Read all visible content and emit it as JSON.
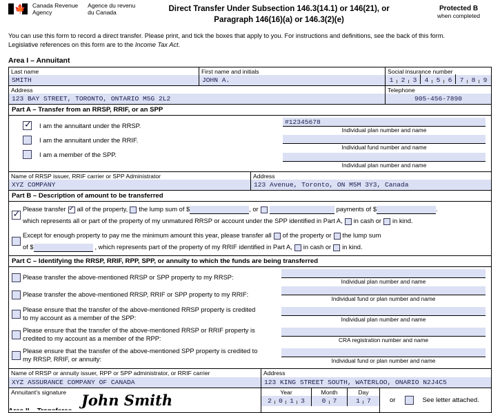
{
  "header": {
    "agency_en": "Canada Revenue\nAgency",
    "agency_en_l1": "Canada Revenue",
    "agency_en_l2": "Agency",
    "agency_fr_l1": "Agence du revenu",
    "agency_fr_l2": "du Canada",
    "title_line1": "Direct Transfer Under Subsection 146.3(14.1) or 146(21), or",
    "title_line2": "Paragraph 146(16)(a) or 146.3(2)(e)",
    "protected_label": "Protected B",
    "protected_sub": "when completed"
  },
  "intro": {
    "line1": "You can use this form to record a direct transfer. Please print, and tick the boxes that apply to you. For instructions and definitions, see the back of this form.",
    "line2_pre": "Legislative references on this form are to the ",
    "line2_italic": "Income Tax Act",
    "line2_post": "."
  },
  "area1": {
    "title": "Area I – Annuitant",
    "last_name_label": "Last name",
    "last_name_value": "SMITH",
    "first_name_label": "First name and initials",
    "first_name_value": "JOHN A.",
    "sin_label": "Social insurance number",
    "sin_digits": [
      "1",
      "2",
      "3",
      "4",
      "5",
      "6",
      "7",
      "8",
      "9"
    ],
    "address_label": "Address",
    "address_value": "123 BAY STREET, TORONTO, ONTARIO M5G 2L2",
    "telephone_label": "Telephone",
    "telephone_value": "905-456-7890"
  },
  "part_a": {
    "heading": "Part A – Transfer from an RRSP, RRIF, or an SPP",
    "options": [
      {
        "label": "I am the annuitant under the RRSP.",
        "checked": true
      },
      {
        "label": "I am the annuitant under the RRIF.",
        "checked": false
      },
      {
        "label": "I am a member of the SPP.",
        "checked": false
      }
    ],
    "fields": [
      {
        "value": "#12345678",
        "caption": "Individual plan number and name"
      },
      {
        "value": "",
        "caption": "Individual fund number and name"
      },
      {
        "value": "",
        "caption": "Individual plan number and name"
      }
    ],
    "issuer_name_label": "Name of RRSP issuer, RRIF carrier or SPP Administrator",
    "issuer_name_value": "XYZ COMPANY",
    "issuer_address_label": "Address",
    "issuer_address_value": "123 Avenue, Toronto, ON M5M 3Y3, Canada"
  },
  "part_b": {
    "heading": "Part B – Description of amount to be transferred",
    "opt1": {
      "checked": true,
      "t1": "Please transfer",
      "cb_all_checked": true,
      "t2": "all of the property,",
      "cb_lump_checked": false,
      "t3": "the lump sum of $",
      "t4": ", or",
      "cb_payments_checked": false,
      "t5": "payments of $",
      "t6": ".",
      "t7": "which represents all or part of the property of my unmatured RRSP or account under the SPP identified in Part A,",
      "cb_cash_checked": false,
      "t8": "in cash or",
      "cb_kind_checked": false,
      "t9": "in kind."
    },
    "opt2": {
      "checked": false,
      "t1": "Except for enough property to pay me the minimum amount this year, please transfer all",
      "cb_property_checked": false,
      "t2": "of the property or",
      "cb_lump_checked": false,
      "t3": "the lump sum",
      "t4": "of $",
      "t5": ", which represents part of the property of my RRIF identified in Part A,",
      "cb_cash_checked": false,
      "t6": "in cash or",
      "cb_kind_checked": false,
      "t7": "in kind."
    }
  },
  "part_c": {
    "heading": "Part C – Identifying the RRSP, RRIF, RPP, SPP, or annuity to which the funds are being transferred",
    "rows": [
      {
        "checked": false,
        "text_lines": [
          "Please transfer the above-mentioned RRSP or SPP property to my RRSP:"
        ],
        "field_value": "",
        "caption": "Individual plan number and name"
      },
      {
        "checked": false,
        "text_lines": [
          "Please transfer the above-mentioned RRSP, RRIF or SPP property to my RRIF:"
        ],
        "field_value": "",
        "caption": "Individual fund or plan number and name"
      },
      {
        "checked": false,
        "text_lines": [
          "Please ensure that the transfer of the above-mentioned RRSP property is credited",
          "to my account as a member of the SPP:"
        ],
        "field_value": "",
        "caption": "Individual plan number and name"
      },
      {
        "checked": false,
        "text_lines": [
          "Please ensure that the transfer of the above-mentioned RRSP or RRIF property is",
          "credited to my account as a member of the RPP:"
        ],
        "field_value": "",
        "caption": "CRA registration number and name"
      },
      {
        "checked": false,
        "text_lines": [
          "Please ensure that the transfer of the above-mentioned SPP property is credited to",
          "my RRSP, RRIF, or annuity:"
        ],
        "field_value": "",
        "caption": "Individual fund or plan number and name"
      }
    ]
  },
  "footer": {
    "issuer_label": "Name of RRSP or annuity issuer, RPP or SPP administrator, or RRIF carrier",
    "issuer_value": "XYZ ASSURANCE COMPANY OF CANADA",
    "address_label": "Address",
    "address_value": "123 KING STREET SOUTH, WATERLOO, ONARIO N2J4C5",
    "signature_label": "Annuitant's signature",
    "signature_value": "John Smith",
    "year_label": "Year",
    "month_label": "Month",
    "day_label": "Day",
    "year_digits": [
      "2",
      "0",
      "1",
      "3"
    ],
    "month_digits": [
      "0",
      "7"
    ],
    "day_digits": [
      "1",
      "7"
    ],
    "or_label": "or",
    "letter_checked": false,
    "letter_label": "See letter attached.",
    "cut_text": "Area II – Transferee"
  }
}
